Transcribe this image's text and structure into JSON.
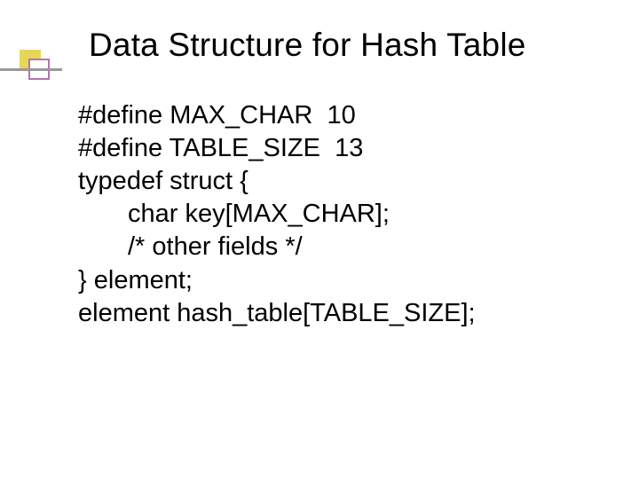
{
  "title": "Data Structure for Hash Table",
  "code": {
    "l1": "#define MAX_CHAR  10",
    "l2": "#define TABLE_SIZE  13",
    "l3": "typedef struct {",
    "l4": "char key[MAX_CHAR];",
    "l5": "/* other fields */",
    "l6": "} element;",
    "l7": "element hash_table[TABLE_SIZE];"
  }
}
